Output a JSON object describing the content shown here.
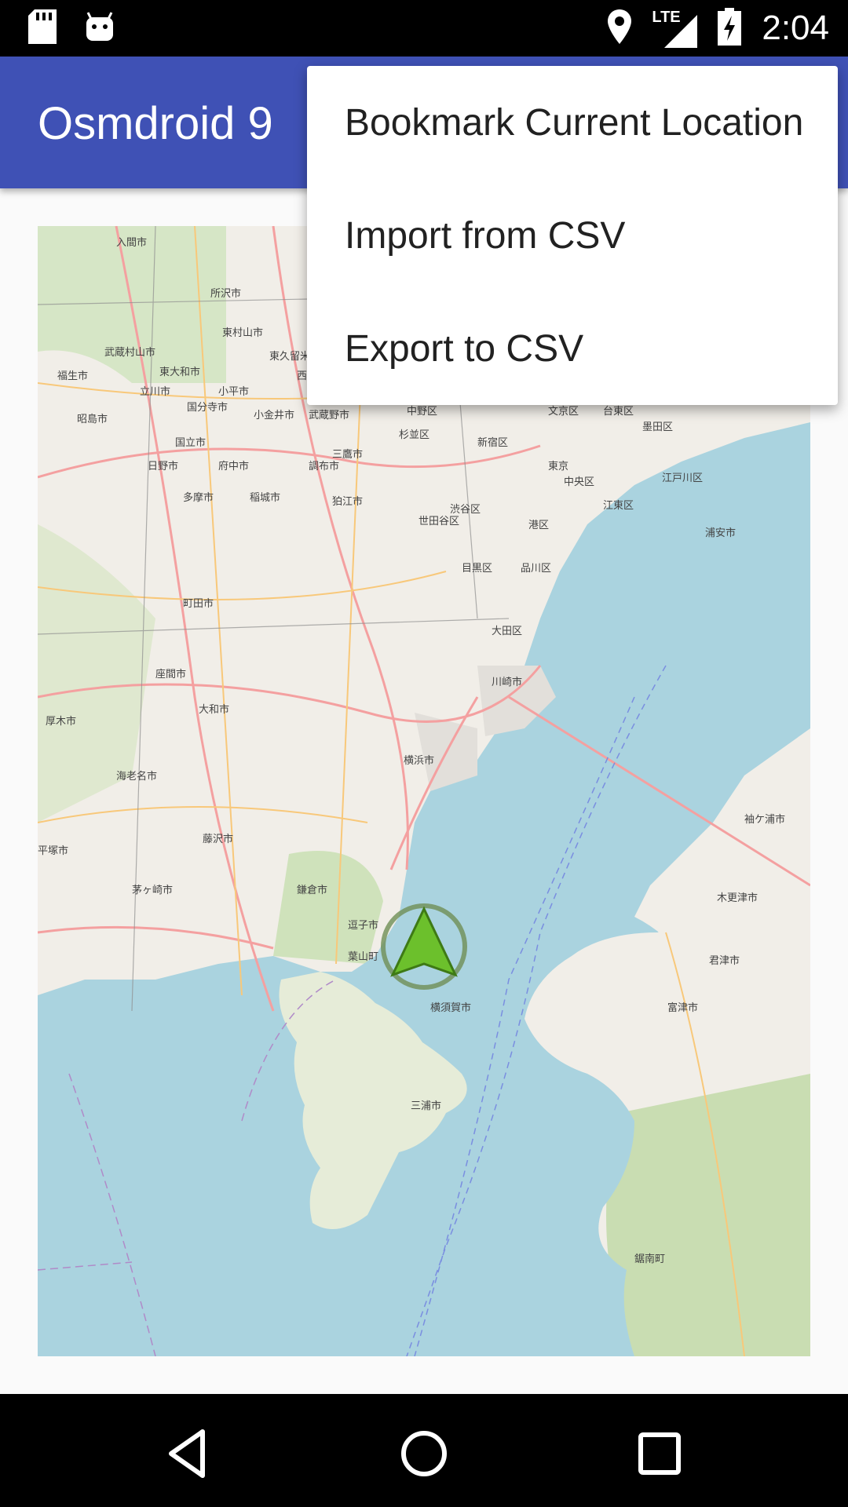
{
  "status_bar": {
    "time": "2:04",
    "network": "LTE",
    "icons": [
      "sd-card-icon",
      "android-icon",
      "location-icon",
      "signal-icon",
      "battery-charging-icon"
    ]
  },
  "app_bar": {
    "title": "Osmdroid 9"
  },
  "overflow_menu": {
    "items": [
      {
        "label": "Bookmark Current Location"
      },
      {
        "label": "Import from CSV"
      },
      {
        "label": "Export to CSV"
      }
    ]
  },
  "map": {
    "labels": [
      "入間市",
      "所沢市",
      "東村山市",
      "東大和市",
      "武蔵村山市",
      "福生市",
      "立川市",
      "小平市",
      "国分寺市",
      "小金井市",
      "昭島市",
      "国立市",
      "日野市",
      "府中市",
      "調布市",
      "多摩市",
      "稲城市",
      "狛江市",
      "町田市",
      "座間市",
      "大和市",
      "厚木市",
      "海老名市",
      "平塚市",
      "藤沢市",
      "茅ヶ崎市",
      "鎌倉市",
      "逗子市",
      "葉山町",
      "横須賀市",
      "三浦市",
      "横浜市",
      "川崎市",
      "大田区",
      "品川区",
      "目黒区",
      "世田谷区",
      "渋谷区",
      "杉並区",
      "中野区",
      "新宿区",
      "文京区",
      "台東区",
      "墨田区",
      "江戸川区",
      "江東区",
      "中央区",
      "港区",
      "東京",
      "浦安市",
      "武蔵野市",
      "三鷹市",
      "木更津市",
      "君津市",
      "富津市",
      "袖ケ浦市",
      "鋸南町",
      "東久留米市",
      "西東京市"
    ],
    "marker": "location-arrow-icon"
  },
  "nav_bar": {
    "buttons": [
      "back-icon",
      "home-icon",
      "recents-icon"
    ]
  }
}
